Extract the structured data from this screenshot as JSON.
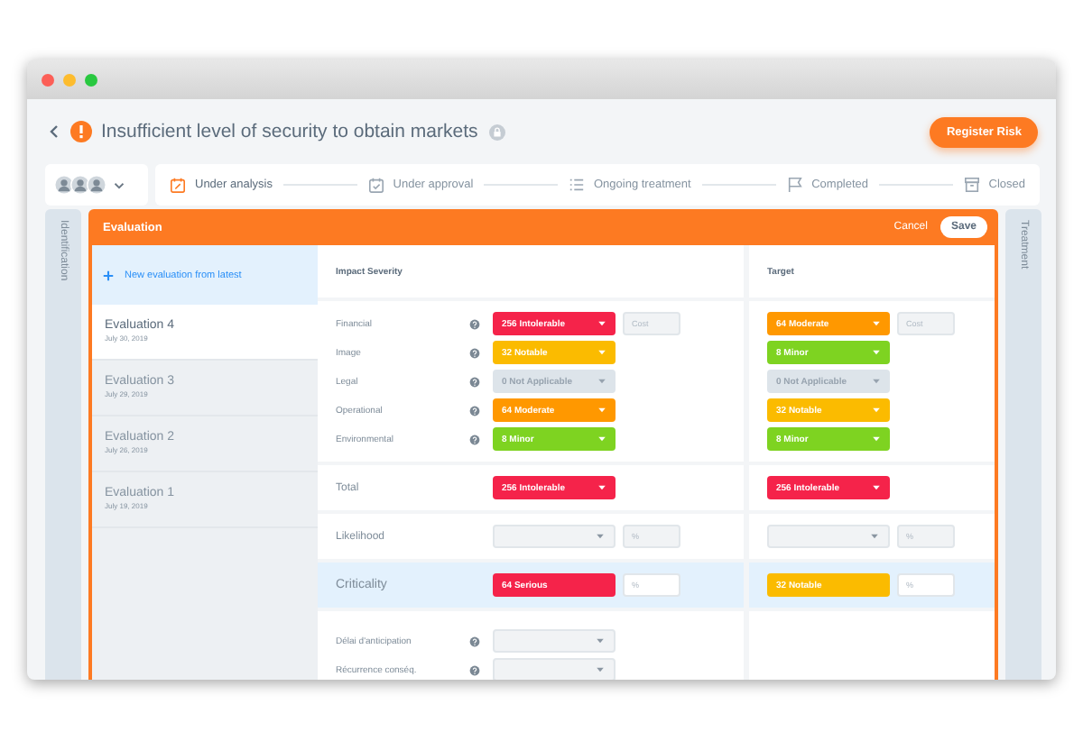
{
  "window": {
    "title": "Insufficient level of security to obtain markets"
  },
  "header": {
    "register_button": "Register Risk"
  },
  "steps": [
    {
      "label": "Under analysis",
      "selected": true
    },
    {
      "label": "Under approval",
      "selected": false
    },
    {
      "label": "Ongoing treatment",
      "selected": false
    },
    {
      "label": "Completed",
      "selected": false
    },
    {
      "label": "Closed",
      "selected": false
    }
  ],
  "side_tabs": {
    "left": "Identification",
    "right": "Treatment"
  },
  "panel": {
    "title": "Evaluation",
    "cancel": "Cancel",
    "save": "Save"
  },
  "new_evaluation": "New evaluation from latest",
  "evaluations": [
    {
      "name": "Evaluation 4",
      "date": "July 30, 2019",
      "selected": true
    },
    {
      "name": "Evaluation 3",
      "date": "July 29, 2019",
      "selected": false
    },
    {
      "name": "Evaluation 2",
      "date": "July 26, 2019",
      "selected": false
    },
    {
      "name": "Evaluation 1",
      "date": "July 19, 2019",
      "selected": false
    }
  ],
  "columns": {
    "impact": "Impact Severity",
    "target": "Target"
  },
  "severity_rows": [
    {
      "label": "Financial",
      "impact": {
        "value": "256 Intolerable",
        "color": "#f5234a"
      },
      "target": {
        "value": "64 Moderate",
        "color": "#ff9800"
      },
      "impact_cost": {
        "placeholder": "Cost"
      },
      "target_cost": {
        "placeholder": "Cost"
      }
    },
    {
      "label": "Image",
      "impact": {
        "value": "32 Notable",
        "color": "#fbbb00"
      },
      "target": {
        "value": "8 Minor",
        "color": "#7ed321"
      }
    },
    {
      "label": "Legal",
      "impact": {
        "value": "0 Not Applicable",
        "color": "#dde4ea"
      },
      "target": {
        "value": "0 Not Applicable",
        "color": "#dde4ea"
      }
    },
    {
      "label": "Operational",
      "impact": {
        "value": "64 Moderate",
        "color": "#ff9800"
      },
      "target": {
        "value": "32 Notable",
        "color": "#fbbb00"
      }
    },
    {
      "label": "Environmental",
      "impact": {
        "value": "8 Minor",
        "color": "#7ed321"
      },
      "target": {
        "value": "8 Minor",
        "color": "#7ed321"
      }
    }
  ],
  "total": {
    "label": "Total",
    "impact": {
      "value": "256 Intolerable",
      "color": "#f5234a"
    },
    "target": {
      "value": "256 Intolerable",
      "color": "#f5234a"
    }
  },
  "likelihood": {
    "label": "Likelihood",
    "impact_percent": {
      "placeholder": "%"
    },
    "target_percent": {
      "placeholder": "%"
    }
  },
  "criticality": {
    "label": "Criticality",
    "impact": {
      "value": "64 Serious",
      "color": "#f5234a"
    },
    "target": {
      "value": "32 Notable",
      "color": "#fbbb00"
    },
    "impact_percent": {
      "placeholder": "%"
    },
    "target_percent": {
      "placeholder": "%"
    }
  },
  "extra_rows": [
    {
      "label": "Délai d'anticipation"
    },
    {
      "label": "Récurrence conséq."
    }
  ]
}
